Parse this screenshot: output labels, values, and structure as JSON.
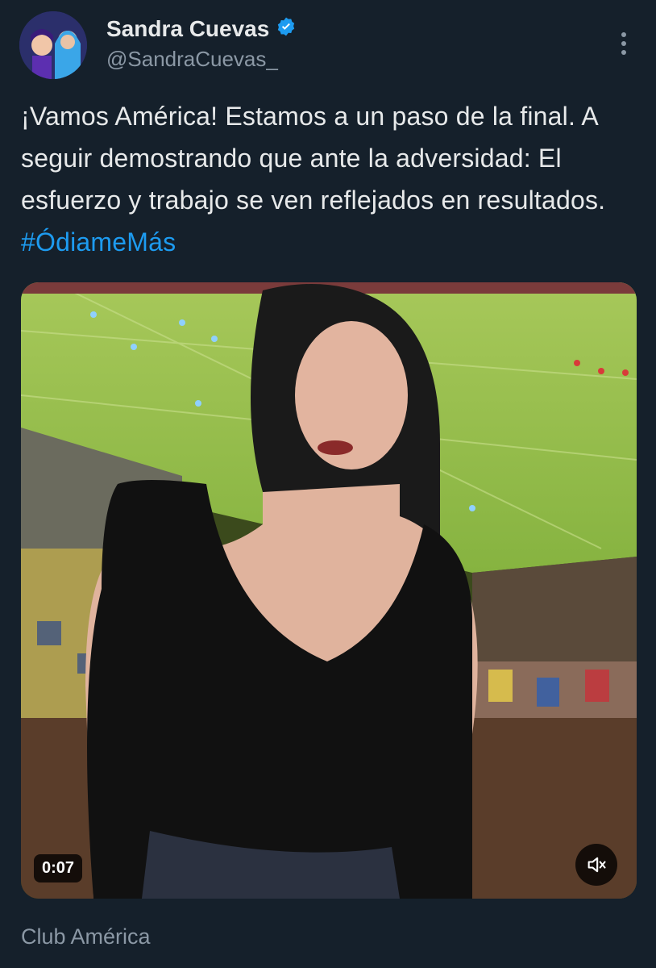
{
  "user": {
    "display_name": "Sandra Cuevas",
    "handle": "@SandraCuevas_",
    "verified_icon": "verified-badge-icon"
  },
  "header": {
    "more_icon": "more-vertical-icon"
  },
  "tweet": {
    "text": "¡Vamos América! Estamos a un paso de la final. A seguir demostrando que ante la adversidad: El esfuerzo y trabajo se ven reflejados en resultados.",
    "hashtag": "#ÓdiameMás"
  },
  "media": {
    "type": "video",
    "duration": "0:07",
    "mute_icon": "volume-muted-icon"
  },
  "footer": {
    "tag": "Club América"
  },
  "colors": {
    "background": "#15202b",
    "text": "#e7e9ea",
    "secondary_text": "#8b98a5",
    "accent": "#1d9bf0"
  }
}
